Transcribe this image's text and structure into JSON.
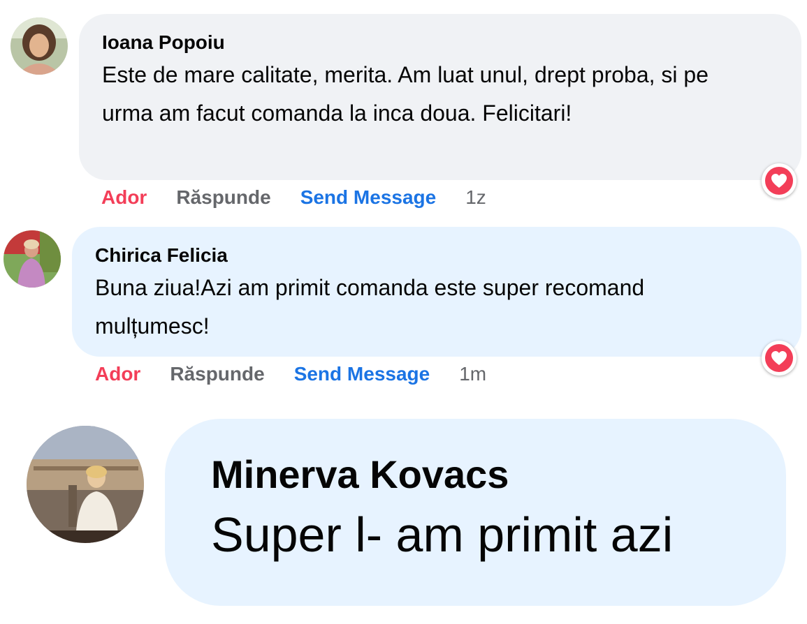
{
  "comments": [
    {
      "author": "Ioana Popoiu",
      "text": "Este de mare calitate, merita. Am luat unul, drept proba, si pe urma am facut comanda la inca doua. Felicitari!",
      "bubble_color": "#f0f2f5",
      "reaction_icon": "heart-icon",
      "actions": {
        "like": "Ador",
        "reply": "Răspunde",
        "message": "Send Message",
        "time": "1z"
      }
    },
    {
      "author": "Chirica Felicia",
      "text": "Buna ziua!Azi am primit comanda este super recomand mulțumesc!",
      "bubble_color": "#e7f3ff",
      "reaction_icon": "heart-icon",
      "actions": {
        "like": "Ador",
        "reply": "Răspunde",
        "message": "Send Message",
        "time": "1m"
      }
    },
    {
      "author": "Minerva Kovacs",
      "text": "Super l- am primit azi",
      "bubble_color": "#e7f3ff"
    }
  ],
  "colors": {
    "like": "#f33e58",
    "muted": "#65676b",
    "link": "#1b74e4",
    "heart": "#f33e58"
  }
}
